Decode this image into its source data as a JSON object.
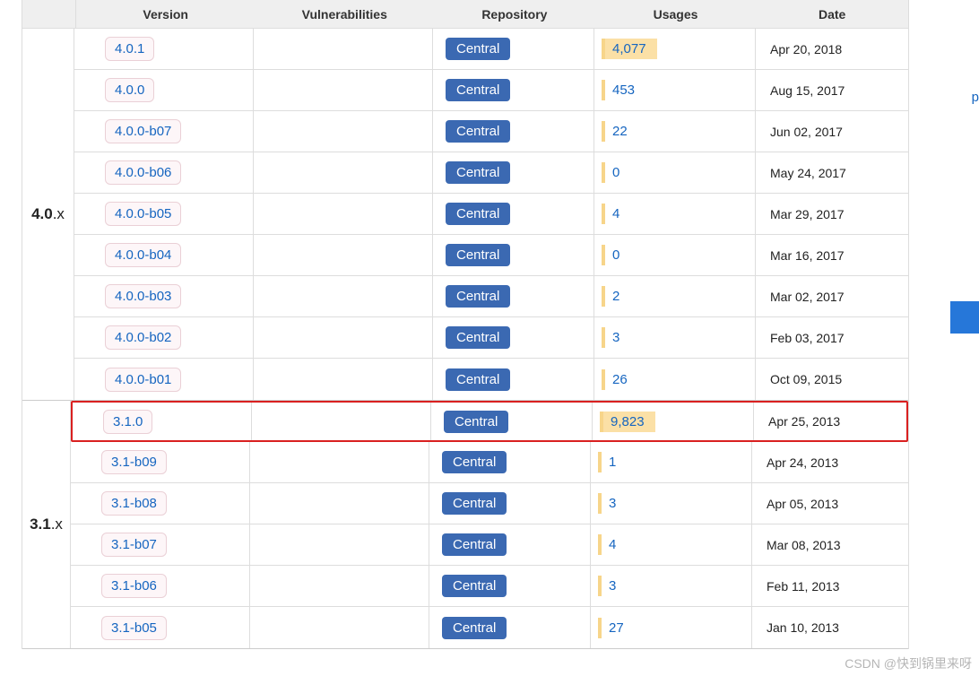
{
  "header": {
    "version": "Version",
    "vulnerabilities": "Vulnerabilities",
    "repository": "Repository",
    "usages": "Usages",
    "date": "Date"
  },
  "groups": [
    {
      "major": "4.0",
      "minor": ".x",
      "rows": [
        {
          "version": "4.0.1",
          "repo": "Central",
          "usages": "4,077",
          "hot": true,
          "date": "Apr 20, 2018",
          "highlight": false
        },
        {
          "version": "4.0.0",
          "repo": "Central",
          "usages": "453",
          "hot": false,
          "date": "Aug 15, 2017",
          "highlight": false
        },
        {
          "version": "4.0.0-b07",
          "repo": "Central",
          "usages": "22",
          "hot": false,
          "date": "Jun 02, 2017",
          "highlight": false
        },
        {
          "version": "4.0.0-b06",
          "repo": "Central",
          "usages": "0",
          "hot": false,
          "date": "May 24, 2017",
          "highlight": false
        },
        {
          "version": "4.0.0-b05",
          "repo": "Central",
          "usages": "4",
          "hot": false,
          "date": "Mar 29, 2017",
          "highlight": false
        },
        {
          "version": "4.0.0-b04",
          "repo": "Central",
          "usages": "0",
          "hot": false,
          "date": "Mar 16, 2017",
          "highlight": false
        },
        {
          "version": "4.0.0-b03",
          "repo": "Central",
          "usages": "2",
          "hot": false,
          "date": "Mar 02, 2017",
          "highlight": false
        },
        {
          "version": "4.0.0-b02",
          "repo": "Central",
          "usages": "3",
          "hot": false,
          "date": "Feb 03, 2017",
          "highlight": false
        },
        {
          "version": "4.0.0-b01",
          "repo": "Central",
          "usages": "26",
          "hot": false,
          "date": "Oct 09, 2015",
          "highlight": false
        }
      ]
    },
    {
      "major": "3.1",
      "minor": ".x",
      "rows": [
        {
          "version": "3.1.0",
          "repo": "Central",
          "usages": "9,823",
          "hot": true,
          "date": "Apr 25, 2013",
          "highlight": true
        },
        {
          "version": "3.1-b09",
          "repo": "Central",
          "usages": "1",
          "hot": false,
          "date": "Apr 24, 2013",
          "highlight": false
        },
        {
          "version": "3.1-b08",
          "repo": "Central",
          "usages": "3",
          "hot": false,
          "date": "Apr 05, 2013",
          "highlight": false
        },
        {
          "version": "3.1-b07",
          "repo": "Central",
          "usages": "4",
          "hot": false,
          "date": "Mar 08, 2013",
          "highlight": false
        },
        {
          "version": "3.1-b06",
          "repo": "Central",
          "usages": "3",
          "hot": false,
          "date": "Feb 11, 2013",
          "highlight": false
        },
        {
          "version": "3.1-b05",
          "repo": "Central",
          "usages": "27",
          "hot": false,
          "date": "Jan 10, 2013",
          "highlight": false
        }
      ]
    }
  ],
  "side": {
    "p": "p"
  },
  "watermark": "CSDN @快到锅里来呀"
}
